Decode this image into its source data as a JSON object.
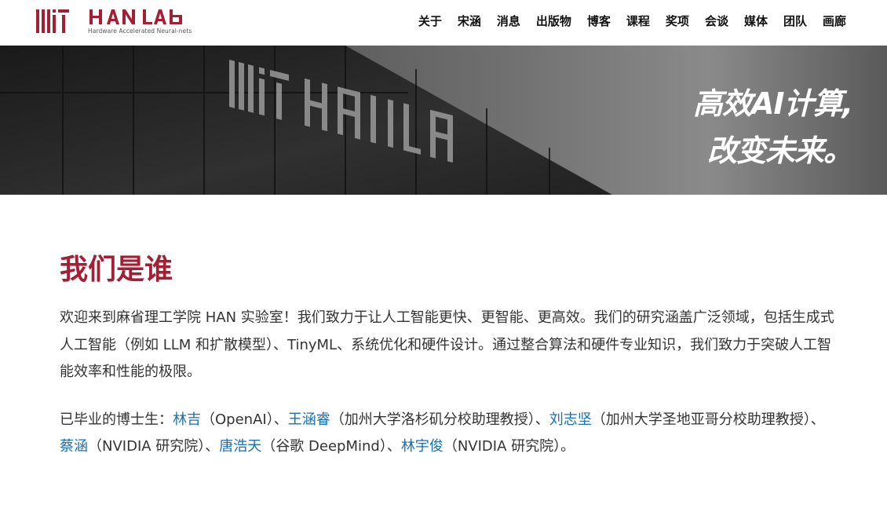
{
  "brand": {
    "logo_text": "MIT HAN LAB",
    "logo_subtitle": "Hardware Accelerated Neural-nets",
    "brand_color": "#a31f34"
  },
  "nav": {
    "items": [
      "关于",
      "宋涵",
      "消息",
      "出版物",
      "博客",
      "课程",
      "奖项",
      "会谈",
      "媒体",
      "团队",
      "画廊"
    ]
  },
  "hero": {
    "line1": "高效AI计算,",
    "line2": "改变未来。",
    "building_sign": "MIT HANLAB"
  },
  "about": {
    "title": "我们是谁",
    "intro": "欢迎来到麻省理工学院 HAN 实验室！我们致力于让人工智能更快、更智能、更高效。我们的研究涵盖广泛领域，包括生成式人工智能（例如 LLM 和扩散模型）、TinyML、系统优化和硬件设计。通过整合算法和硬件专业知识，我们致力于突破人工智能效率和性能的极限。",
    "alumni_prefix": "已毕业的博士生：",
    "alumni": [
      {
        "name": "林吉",
        "affiliation": "（OpenAI）"
      },
      {
        "name": "王涵睿",
        "affiliation": "（加州大学洛杉矶分校助理教授）"
      },
      {
        "name": "刘志坚",
        "affiliation": "（加州大学圣地亚哥分校助理教授）"
      },
      {
        "name": "蔡涵",
        "affiliation": "（NVIDIA 研究院）"
      },
      {
        "name": "唐浩天",
        "affiliation": "（谷歌 DeepMind）"
      },
      {
        "name": "林宇俊",
        "affiliation": "（NVIDIA 研究院）"
      }
    ],
    "separator": "、",
    "alumni_suffix": "。",
    "link_color": "#1a6fb0"
  }
}
